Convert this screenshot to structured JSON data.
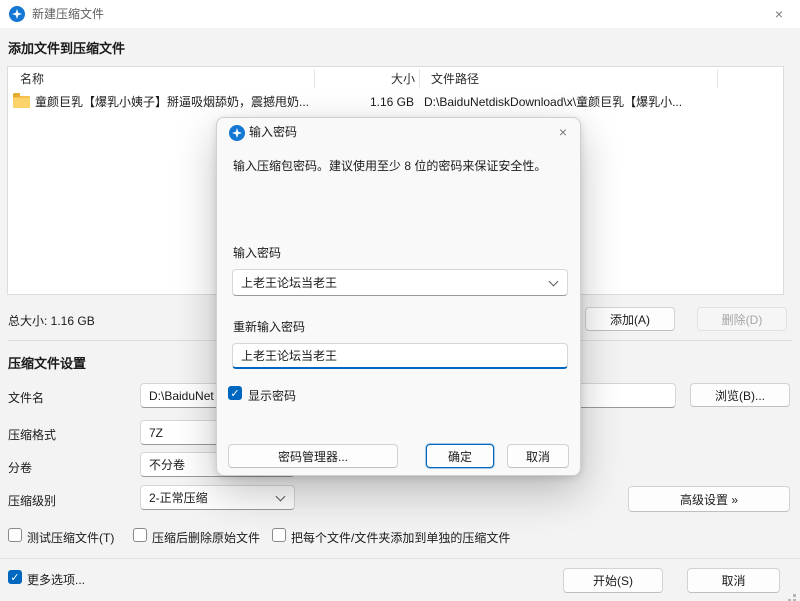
{
  "window": {
    "title": "新建压缩文件",
    "close_glyph": "×"
  },
  "section_add": "添加文件到压缩文件",
  "section_settings": "压缩文件设置",
  "table": {
    "col_name": "名称",
    "col_size": "大小",
    "col_path": "文件路径",
    "row": {
      "name": "童颜巨乳【爆乳小姨子】掰逼吸烟舔奶，震撼甩奶...",
      "size": "1.16 GB",
      "path": "D:\\BaiduNetdiskDownload\\x\\童颜巨乳【爆乳小..."
    }
  },
  "total_size": "总大小: 1.16 GB",
  "buttons": {
    "add": "添加(A)",
    "delete": "删除(D)",
    "browse": "浏览(B)...",
    "advanced": "高级设置 »",
    "start": "开始(S)",
    "cancel": "取消"
  },
  "form": {
    "filename_label": "文件名",
    "filename_value": "D:\\BaiduNet",
    "format_label": "压缩格式",
    "format_value": "7Z",
    "volume_label": "分卷",
    "volume_value": "不分卷",
    "level_label": "压缩级别",
    "level_value": "2-正常压缩"
  },
  "options": {
    "test": "测试压缩文件(T)",
    "delete_original": "压缩后删除原始文件",
    "separate": "把每个文件/文件夹添加到单独的压缩文件",
    "more": "更多选项...",
    "check_glyph": "✓"
  },
  "dialog": {
    "title": "输入密码",
    "close_glyph": "×",
    "description": "输入压缩包密码。建议使用至少 8 位的密码来保证安全性。",
    "password_label": "输入密码",
    "password_value": "上老王论坛当老王",
    "confirm_label": "重新输入密码",
    "confirm_value": "上老王论坛当老王",
    "show_password": "显示密码",
    "manager": "密码管理器...",
    "ok": "确定",
    "cancel": "取消"
  },
  "colors": {
    "accent": "#0067c0",
    "folder": "#f5c14b"
  }
}
